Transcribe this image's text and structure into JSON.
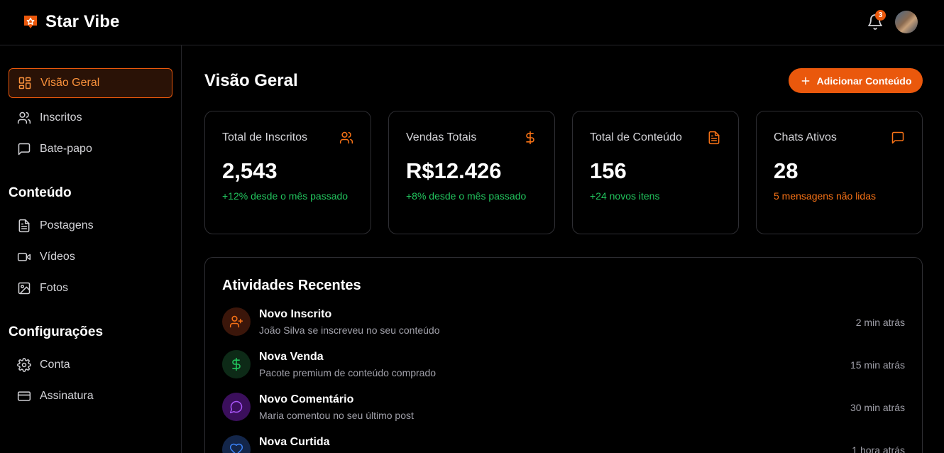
{
  "brand": {
    "name": "Star Vibe",
    "accent": "#ea580c"
  },
  "header": {
    "notifications_count": "3"
  },
  "sidebar": {
    "items": [
      {
        "label": "Visão Geral",
        "icon": "dashboard-icon",
        "active": true
      },
      {
        "label": "Inscritos",
        "icon": "users-icon"
      },
      {
        "label": "Bate-papo",
        "icon": "chat-icon"
      }
    ],
    "sections": [
      {
        "title": "Conteúdo",
        "items": [
          {
            "label": "Postagens",
            "icon": "document-icon"
          },
          {
            "label": "Vídeos",
            "icon": "video-icon"
          },
          {
            "label": "Fotos",
            "icon": "image-icon"
          }
        ]
      },
      {
        "title": "Configurações",
        "items": [
          {
            "label": "Conta",
            "icon": "gear-icon"
          },
          {
            "label": "Assinatura",
            "icon": "credit-card-icon"
          }
        ]
      }
    ]
  },
  "main": {
    "title": "Visão Geral",
    "add_button": "Adicionar Conteúdo",
    "stats": [
      {
        "label": "Total de Inscritos",
        "value": "2,543",
        "sub": "+12% desde o mês passado",
        "sub_color": "#22c55e",
        "icon": "users-icon"
      },
      {
        "label": "Vendas Totais",
        "value": "R$12.426",
        "sub": "+8% desde o mês passado",
        "sub_color": "#22c55e",
        "icon": "dollar-icon"
      },
      {
        "label": "Total de Conteúdo",
        "value": "156",
        "sub": "+24 novos itens",
        "sub_color": "#22c55e",
        "icon": "document-icon"
      },
      {
        "label": "Chats Ativos",
        "value": "28",
        "sub": "5 mensagens não lidas",
        "sub_color": "#f97316",
        "icon": "chat-icon"
      }
    ],
    "activity": {
      "title": "Atividades Recentes",
      "items": [
        {
          "title": "Novo Inscrito",
          "desc": "João Silva se inscreveu no seu conteúdo",
          "time": "2 min atrás",
          "icon": "user-plus-icon",
          "color": "#f97316",
          "bg": "#3b160a"
        },
        {
          "title": "Nova Venda",
          "desc": "Pacote premium de conteúdo comprado",
          "time": "15 min atrás",
          "icon": "dollar-icon",
          "color": "#22c55e",
          "bg": "#0d2a17"
        },
        {
          "title": "Novo Comentário",
          "desc": "Maria comentou no seu último post",
          "time": "30 min atrás",
          "icon": "message-icon",
          "color": "#a855f7",
          "bg": "#3b0f5c"
        },
        {
          "title": "Nova Curtida",
          "desc": "",
          "time": "1 hora atrás",
          "icon": "heart-icon",
          "color": "#3b82f6",
          "bg": "#13264a"
        }
      ]
    }
  }
}
